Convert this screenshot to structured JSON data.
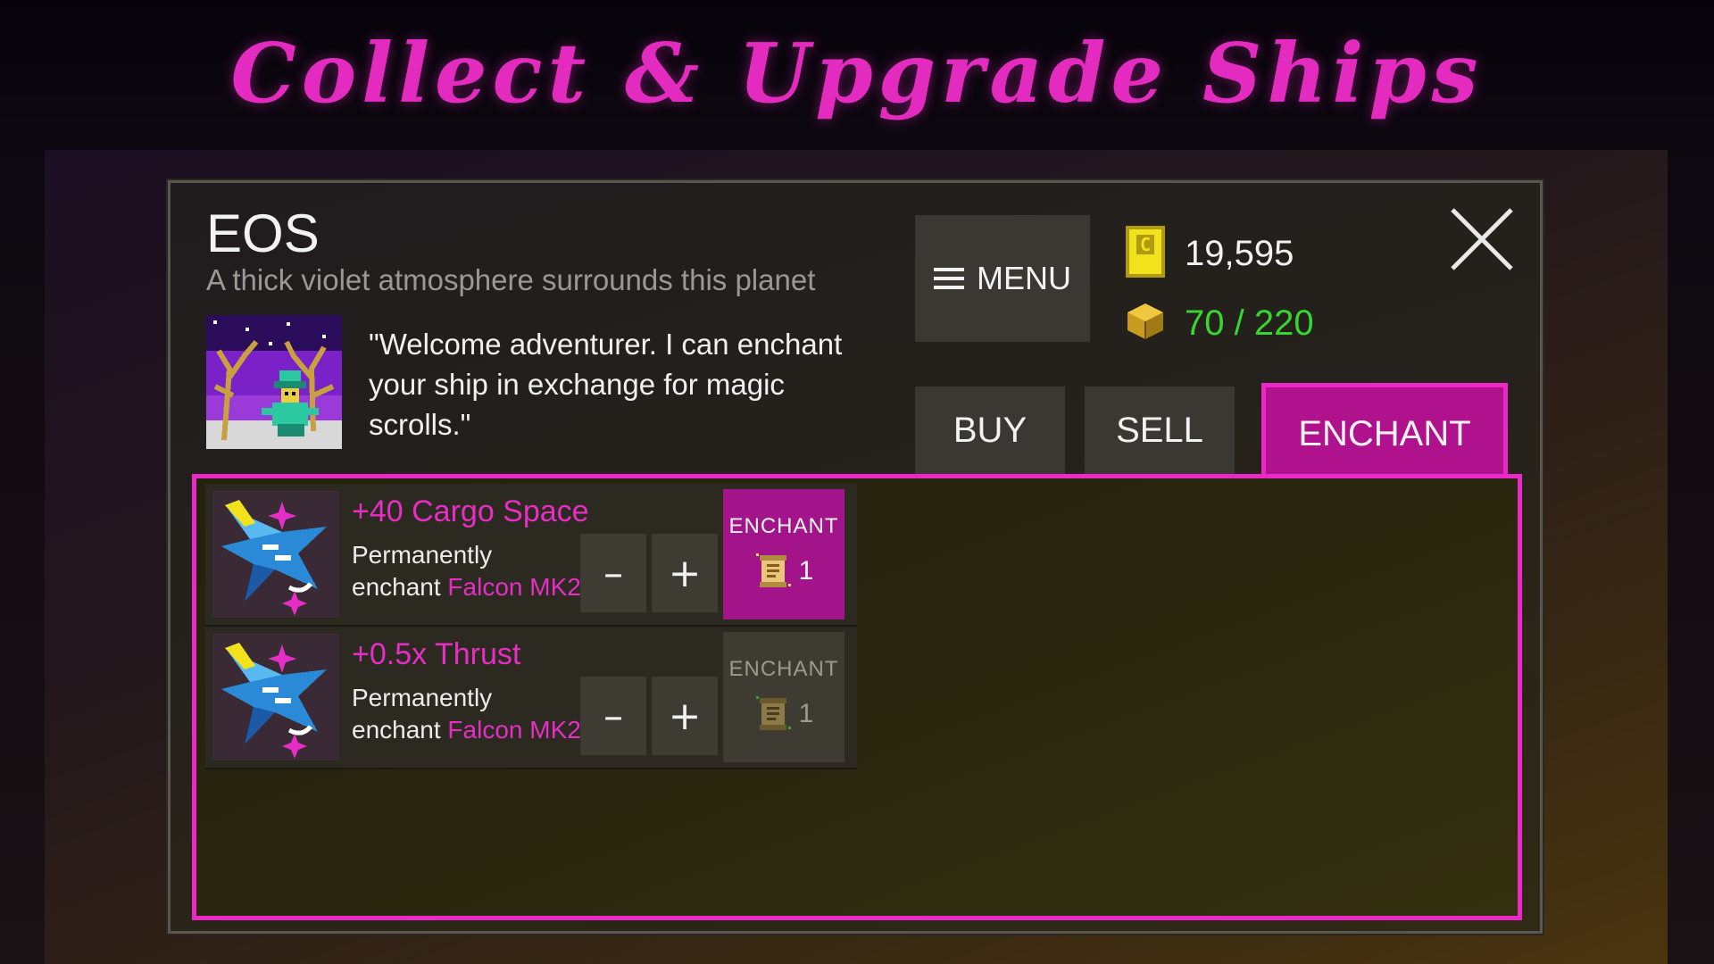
{
  "banner": {
    "title": "Collect & Upgrade Ships"
  },
  "planet": {
    "name": "EOS",
    "description": "A thick violet atmosphere surrounds this planet"
  },
  "npc": {
    "dialog": "\"Welcome adventurer. I can enchant your ship in exchange for magic scrolls.\""
  },
  "menu": {
    "label": "MENU"
  },
  "currency": {
    "credits": "19,595",
    "cargo": "70 / 220",
    "credits_icon": "credit-card-icon",
    "cargo_icon": "cargo-crate-icon"
  },
  "tabs": [
    {
      "label": "BUY",
      "active": false
    },
    {
      "label": "SELL",
      "active": false
    },
    {
      "label": "ENCHANT",
      "active": true
    }
  ],
  "enchantments": [
    {
      "title": "+40 Cargo Space",
      "desc_prefix": "Permanently",
      "desc_verb": "enchant",
      "ship": "Falcon MK2",
      "minus": "–",
      "plus": "+",
      "button_label": "ENCHANT",
      "cost": "1",
      "enabled": true
    },
    {
      "title": "+0.5x Thrust",
      "desc_prefix": "Permanently",
      "desc_verb": "enchant",
      "ship": "Falcon MK2",
      "minus": "–",
      "plus": "+",
      "button_label": "ENCHANT",
      "cost": "1",
      "enabled": false
    }
  ],
  "colors": {
    "accent": "#e62ec4",
    "active_tab": "#b0128e",
    "cargo_text": "#37d62e"
  }
}
